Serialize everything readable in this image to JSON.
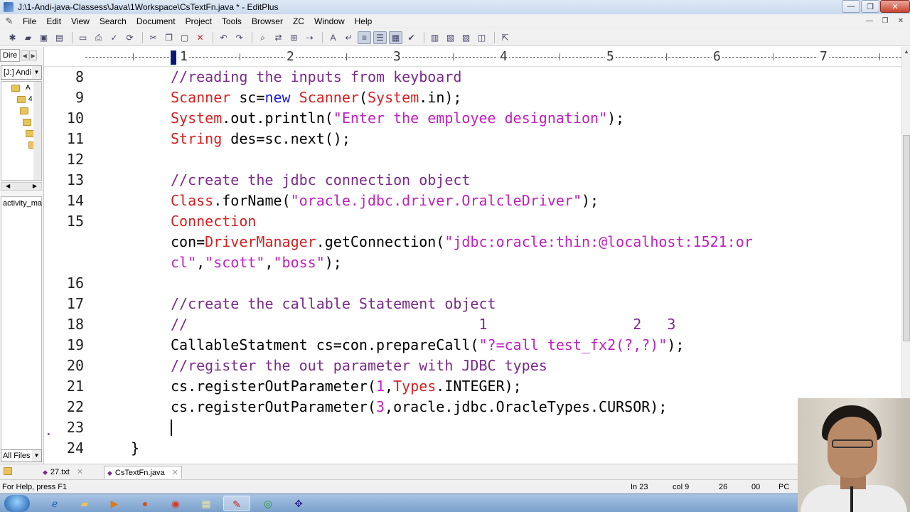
{
  "window": {
    "title": "J:\\1-Andi-java-Classess\\Java\\1Workspace\\CsTextFn.java * - EditPlus",
    "minimize": "—",
    "maximize": "❐",
    "close": "✕"
  },
  "menu": {
    "items": [
      "File",
      "Edit",
      "View",
      "Search",
      "Document",
      "Project",
      "Tools",
      "Browser",
      "ZC",
      "Window",
      "Help"
    ],
    "mdi": [
      "—",
      "❐",
      "✕"
    ]
  },
  "left_panel": {
    "tab_label": "Dire",
    "drive": "[J:] Andi",
    "tree": [
      {
        "label": "A"
      },
      {
        "label": "4"
      },
      {
        "label": ""
      },
      {
        "label": ""
      },
      {
        "label": ""
      },
      {
        "label": ""
      }
    ],
    "file": "activity_ma",
    "filter": "All Files"
  },
  "ruler": {
    "numbers": [
      "1",
      "2",
      "3",
      "4",
      "5",
      "6",
      "7"
    ]
  },
  "editor": {
    "lines": [
      {
        "num": "8",
        "segments": [
          {
            "t": "//reading the inputs from keyboard",
            "c": "cmt"
          }
        ]
      },
      {
        "num": "9",
        "segments": [
          {
            "t": "Scanner",
            "c": "red"
          },
          {
            "t": " sc=",
            "c": ""
          },
          {
            "t": "new",
            "c": "blue"
          },
          {
            "t": " ",
            "c": ""
          },
          {
            "t": "Scanner",
            "c": "red"
          },
          {
            "t": "(",
            "c": ""
          },
          {
            "t": "System",
            "c": "red"
          },
          {
            "t": ".in);",
            "c": ""
          }
        ]
      },
      {
        "num": "10",
        "segments": [
          {
            "t": "System",
            "c": "red"
          },
          {
            "t": ".out.println(",
            "c": ""
          },
          {
            "t": "\"Enter the employee designation\"",
            "c": "str"
          },
          {
            "t": ");",
            "c": ""
          }
        ]
      },
      {
        "num": "11",
        "segments": [
          {
            "t": "String",
            "c": "red"
          },
          {
            "t": " des=sc.next();",
            "c": ""
          }
        ]
      },
      {
        "num": "12",
        "segments": []
      },
      {
        "num": "13",
        "segments": [
          {
            "t": "//create the jdbc connection object",
            "c": "cmt"
          }
        ]
      },
      {
        "num": "14",
        "segments": [
          {
            "t": "Class",
            "c": "red"
          },
          {
            "t": ".forName(",
            "c": ""
          },
          {
            "t": "\"oracle.jdbc.driver.OralcleDriver\"",
            "c": "str"
          },
          {
            "t": ");",
            "c": ""
          }
        ]
      },
      {
        "num": "15",
        "segments": [
          {
            "t": "Connection",
            "c": "red"
          }
        ]
      },
      {
        "num": "",
        "segments": [
          {
            "t": "con=",
            "c": ""
          },
          {
            "t": "DriverManager",
            "c": "red"
          },
          {
            "t": ".getConnection(",
            "c": ""
          },
          {
            "t": "\"jdbc:oracle:thin:@localhost:1521:or",
            "c": "str"
          }
        ]
      },
      {
        "num": "",
        "segments": [
          {
            "t": "cl\"",
            "c": "str"
          },
          {
            "t": ",",
            "c": ""
          },
          {
            "t": "\"scott\"",
            "c": "str"
          },
          {
            "t": ",",
            "c": ""
          },
          {
            "t": "\"boss\"",
            "c": "str"
          },
          {
            "t": ");",
            "c": ""
          }
        ]
      },
      {
        "num": "16",
        "segments": []
      },
      {
        "num": "17",
        "segments": [
          {
            "t": "//create the callable Statement object",
            "c": "cmt"
          }
        ]
      },
      {
        "num": "18",
        "segments": [
          {
            "t": "//                                  1                 2   3",
            "c": "cmt"
          }
        ]
      },
      {
        "num": "19",
        "segments": [
          {
            "t": "CallableStatment cs=con.prepareCall(",
            "c": ""
          },
          {
            "t": "\"?=call test_fx2(?,?)\"",
            "c": "str"
          },
          {
            "t": ");",
            "c": ""
          }
        ]
      },
      {
        "num": "20",
        "segments": [
          {
            "t": "//register the out parameter with JDBC types",
            "c": "cmt"
          }
        ]
      },
      {
        "num": "21",
        "segments": [
          {
            "t": "cs.registerOutParameter(",
            "c": ""
          },
          {
            "t": "1",
            "c": "str"
          },
          {
            "t": ",",
            "c": ""
          },
          {
            "t": "Types",
            "c": "red"
          },
          {
            "t": ".INTEGER);",
            "c": ""
          }
        ]
      },
      {
        "num": "22",
        "segments": [
          {
            "t": "cs.registerOutParameter(",
            "c": ""
          },
          {
            "t": "3",
            "c": "str"
          },
          {
            "t": ",oracle.jdbc.OracleTypes.CURSOR);",
            "c": ""
          }
        ]
      },
      {
        "num": "23",
        "segments": []
      },
      {
        "num": "24",
        "segments": [
          {
            "t": "}",
            "c": ""
          }
        ]
      }
    ]
  },
  "file_tabs": [
    {
      "label": "27.txt",
      "active": false
    },
    {
      "label": "CsTextFn.java",
      "active": true
    }
  ],
  "status": {
    "help": "For Help, press F1",
    "line": "In 23",
    "col": "col 9",
    "chars": "26",
    "code": "00",
    "mode": "PC"
  },
  "taskbar": {
    "icons": [
      "ie-icon",
      "explorer-icon",
      "media-player-icon",
      "firefox-icon",
      "chrome-icon",
      "folder-icon",
      "editplus-icon",
      "qt-icon",
      "toolkit-icon"
    ]
  }
}
